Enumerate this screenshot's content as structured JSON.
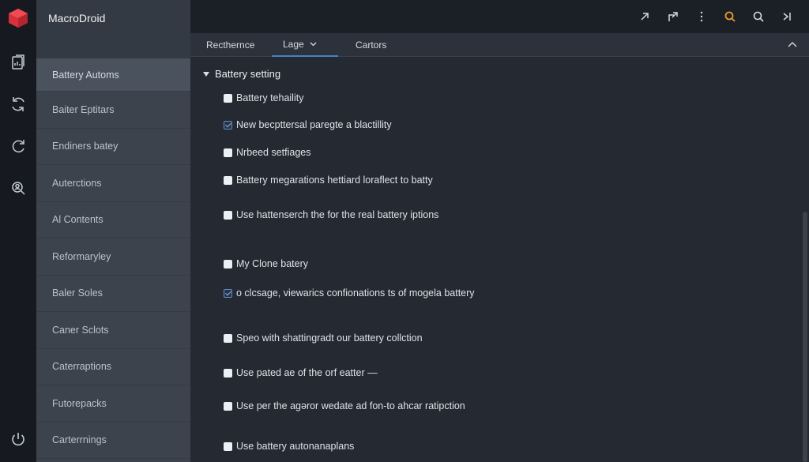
{
  "app": {
    "title": "MacroDroid",
    "brand_color": "#d9313b"
  },
  "rail": {
    "icons": [
      "app-logo-icon",
      "document-chart-icon",
      "refresh-loop-icon",
      "sync-icon",
      "search-person-icon"
    ],
    "bottom_icon": "power-icon"
  },
  "sidebar": {
    "items": [
      {
        "label": "Battery Automs",
        "active": true
      },
      {
        "label": "Baiter Eptitars",
        "active": false
      },
      {
        "label": "Endiners batey",
        "active": false
      },
      {
        "label": "Auterctions",
        "active": false
      },
      {
        "label": "Al Contents",
        "active": false
      },
      {
        "label": "Reformaryley",
        "active": false
      },
      {
        "label": "Baler Soles",
        "active": false
      },
      {
        "label": "Caner Sclots",
        "active": false
      },
      {
        "label": "Caterraptions",
        "active": false
      },
      {
        "label": "Futorepacks",
        "active": false
      },
      {
        "label": "Carterrnings",
        "active": false
      }
    ]
  },
  "toolbar": {
    "icons": [
      "arrow-up-right-icon",
      "share-icon",
      "more-vertical-icon",
      "search-highlight-icon",
      "search-icon",
      "collapse-icon"
    ],
    "accent_color": "#e89a2c"
  },
  "tabs": [
    {
      "label": "Recthernce",
      "active": false
    },
    {
      "label": "Lage",
      "active": true,
      "has_dropdown": true
    },
    {
      "label": "Cartors",
      "active": false
    }
  ],
  "section": {
    "title": "Battery setting",
    "options": [
      {
        "label": "Battery tehaility",
        "checked": false
      },
      {
        "label": "New becpttersal paregte a blactillity",
        "checked": true
      },
      {
        "label": "Nrbeed setfiages",
        "checked": false
      },
      {
        "label": "Battery megarations hettiard loraflect to batty",
        "checked": false
      },
      {
        "label": "Use hattenserch the for the real battery iptions",
        "checked": false
      },
      {
        "label": "My Clone batery",
        "checked": false
      },
      {
        "label": "o clcsage, viewarics confionations ts of mogela battery",
        "checked": true
      },
      {
        "label": "Speo with shattingradt our battery collction",
        "checked": false
      },
      {
        "label": "Use pated ae of the orf eatter —",
        "checked": false
      },
      {
        "label": "Use per the agəror wedate ad fon-to ahcar ratipction",
        "checked": false
      },
      {
        "label": "Use battery autonanaplans",
        "checked": false
      }
    ]
  }
}
